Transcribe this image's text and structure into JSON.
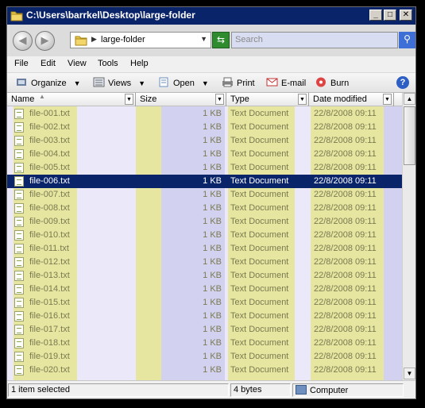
{
  "window": {
    "title": "C:\\Users\\barrkel\\Desktop\\large-folder",
    "controls": {
      "minimize": "_",
      "maximize": "□",
      "close": "✕"
    }
  },
  "address": {
    "path": "large-folder",
    "search_placeholder": "Search"
  },
  "menu": [
    "File",
    "Edit",
    "View",
    "Tools",
    "Help"
  ],
  "toolbar": {
    "organize": "Organize",
    "views": "Views",
    "open": "Open",
    "print": "Print",
    "email": "E-mail",
    "burn": "Burn",
    "help": "?"
  },
  "columns": {
    "name": "Name",
    "size": "Size",
    "type": "Type",
    "date": "Date modified"
  },
  "files": [
    {
      "name": "file-001.txt",
      "size": "1 KB",
      "type": "Text Document",
      "date": "22/8/2008 09:11"
    },
    {
      "name": "file-002.txt",
      "size": "1 KB",
      "type": "Text Document",
      "date": "22/8/2008 09:11"
    },
    {
      "name": "file-003.txt",
      "size": "1 KB",
      "type": "Text Document",
      "date": "22/8/2008 09:11"
    },
    {
      "name": "file-004.txt",
      "size": "1 KB",
      "type": "Text Document",
      "date": "22/8/2008 09:11"
    },
    {
      "name": "file-005.txt",
      "size": "1 KB",
      "type": "Text Document",
      "date": "22/8/2008 09:11"
    },
    {
      "name": "file-006.txt",
      "size": "1 KB",
      "type": "Text Document",
      "date": "22/8/2008 09:11"
    },
    {
      "name": "file-007.txt",
      "size": "1 KB",
      "type": "Text Document",
      "date": "22/8/2008 09:11"
    },
    {
      "name": "file-008.txt",
      "size": "1 KB",
      "type": "Text Document",
      "date": "22/8/2008 09:11"
    },
    {
      "name": "file-009.txt",
      "size": "1 KB",
      "type": "Text Document",
      "date": "22/8/2008 09:11"
    },
    {
      "name": "file-010.txt",
      "size": "1 KB",
      "type": "Text Document",
      "date": "22/8/2008 09:11"
    },
    {
      "name": "file-011.txt",
      "size": "1 KB",
      "type": "Text Document",
      "date": "22/8/2008 09:11"
    },
    {
      "name": "file-012.txt",
      "size": "1 KB",
      "type": "Text Document",
      "date": "22/8/2008 09:11"
    },
    {
      "name": "file-013.txt",
      "size": "1 KB",
      "type": "Text Document",
      "date": "22/8/2008 09:11"
    },
    {
      "name": "file-014.txt",
      "size": "1 KB",
      "type": "Text Document",
      "date": "22/8/2008 09:11"
    },
    {
      "name": "file-015.txt",
      "size": "1 KB",
      "type": "Text Document",
      "date": "22/8/2008 09:11"
    },
    {
      "name": "file-016.txt",
      "size": "1 KB",
      "type": "Text Document",
      "date": "22/8/2008 09:11"
    },
    {
      "name": "file-017.txt",
      "size": "1 KB",
      "type": "Text Document",
      "date": "22/8/2008 09:11"
    },
    {
      "name": "file-018.txt",
      "size": "1 KB",
      "type": "Text Document",
      "date": "22/8/2008 09:11"
    },
    {
      "name": "file-019.txt",
      "size": "1 KB",
      "type": "Text Document",
      "date": "22/8/2008 09:11"
    },
    {
      "name": "file-020.txt",
      "size": "1 KB",
      "type": "Text Document",
      "date": "22/8/2008 09:11"
    }
  ],
  "selected_file": "file-006.txt",
  "status": {
    "selection": "1 item selected",
    "size": "4 bytes",
    "location": "Computer"
  },
  "colors": {
    "titlebar": "#0a246a",
    "selection": "#0a246a",
    "name_highlight": "#e6e6a0",
    "type_highlight": "#e6e6a0",
    "column_lavender": "#ebe8fa",
    "column_blue": "#d2d2f0"
  },
  "icons": [
    "folder-icon",
    "back-icon",
    "forward-icon",
    "refresh-icon",
    "search-icon",
    "organize-icon",
    "views-icon",
    "open-icon",
    "print-icon",
    "email-icon",
    "burn-icon",
    "help-icon",
    "text-file-icon",
    "computer-icon"
  ]
}
